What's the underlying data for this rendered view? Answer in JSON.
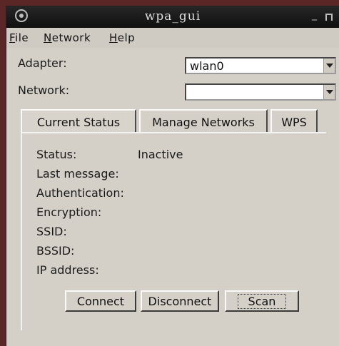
{
  "window": {
    "title": "wpa_gui",
    "minimize": "_"
  },
  "menu": {
    "file": "File",
    "file_mnemonic": "F",
    "file_rest": "ile",
    "network": "Network",
    "network_mnemonic": "N",
    "network_rest": "etwork",
    "help": "Help",
    "help_mnemonic": "H",
    "help_rest": "elp"
  },
  "adapter": {
    "label": "Adapter:",
    "value": "wlan0"
  },
  "network": {
    "label": "Network:",
    "value": ""
  },
  "tabs": [
    {
      "label": "Current Status",
      "active": true
    },
    {
      "label": "Manage Networks",
      "active": false
    },
    {
      "label": "WPS",
      "active": false
    }
  ],
  "status": {
    "status_label": "Status:",
    "status_value": "Inactive",
    "last_message_label": "Last message:",
    "authentication_label": "Authentication:",
    "encryption_label": "Encryption:",
    "ssid_label": "SSID:",
    "bssid_label": "BSSID:",
    "ip_address_label": "IP address:"
  },
  "buttons": {
    "connect": "Connect",
    "disconnect": "Disconnect",
    "scan": "Scan"
  },
  "icons": {
    "app": "wpa-gui-app-icon",
    "minimize": "minimize-icon",
    "maximize": "maximize-icon",
    "dropdown": "chevron-down-icon"
  }
}
